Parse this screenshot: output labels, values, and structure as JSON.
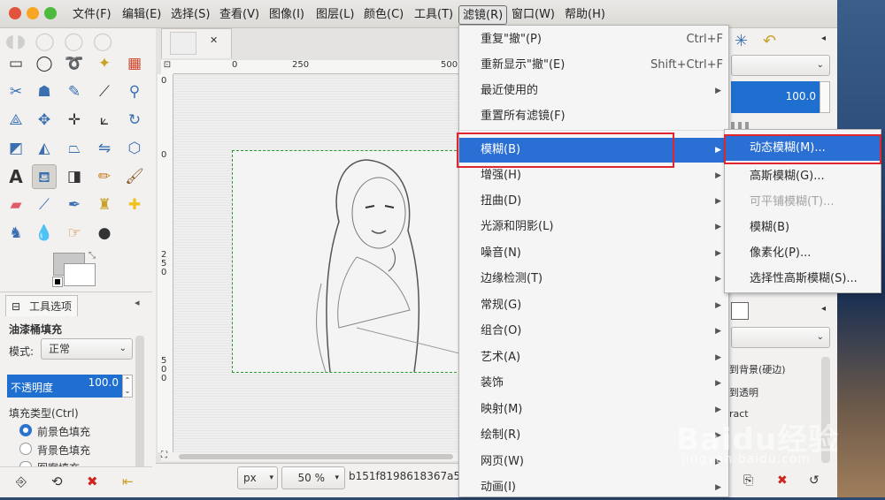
{
  "menubar": {
    "items": [
      "文件(F)",
      "编辑(E)",
      "选择(S)",
      "查看(V)",
      "图像(I)",
      "图层(L)",
      "颜色(C)",
      "工具(T)",
      "滤镜(R)",
      "窗口(W)",
      "帮助(H)"
    ],
    "active": "滤镜(R)"
  },
  "image_tab": {
    "close": "✕"
  },
  "ruler": {
    "h0": "0",
    "h250": "250",
    "h500": "500",
    "v0": "0",
    "v250": "250",
    "v500": "500"
  },
  "tool_options": {
    "tab_label": "工具选项",
    "title": "油漆桶填充",
    "mode_label": "模式:",
    "mode_value": "正常",
    "opacity_label": "不透明度",
    "opacity_value": "100.0",
    "fill_type_label": "填充类型(Ctrl)",
    "fill_options": [
      "前景色填充",
      "背景色填充",
      "图案填充"
    ],
    "fill_selected": 0
  },
  "statusbar": {
    "unit": "px",
    "zoom": "50 %",
    "filename": "b151f8198618367a5"
  },
  "filters_menu": {
    "items": [
      {
        "label": "重复\"撤\"(P)",
        "shortcut": "Ctrl+F"
      },
      {
        "label": "重新显示\"撤\"(E)",
        "shortcut": "Shift+Ctrl+F"
      },
      {
        "label": "最近使用的",
        "submenu": true
      },
      {
        "label": "重置所有滤镜(F)"
      },
      {
        "label": "模糊(B)",
        "submenu": true,
        "highlighted": true
      },
      {
        "label": "增强(H)",
        "submenu": true
      },
      {
        "label": "扭曲(D)",
        "submenu": true
      },
      {
        "label": "光源和阴影(L)",
        "submenu": true
      },
      {
        "label": "噪音(N)",
        "submenu": true
      },
      {
        "label": "边缘检测(T)",
        "submenu": true
      },
      {
        "label": "常规(G)",
        "submenu": true
      },
      {
        "label": "组合(O)",
        "submenu": true
      },
      {
        "label": "艺术(A)",
        "submenu": true
      },
      {
        "label": "装饰",
        "submenu": true
      },
      {
        "label": "映射(M)",
        "submenu": true
      },
      {
        "label": "绘制(R)",
        "submenu": true
      },
      {
        "label": "网页(W)",
        "submenu": true
      },
      {
        "label": "动画(I)",
        "submenu": true
      }
    ]
  },
  "blur_submenu": {
    "items": [
      {
        "label": "动态模糊(M)...",
        "highlighted": true
      },
      {
        "label": "高斯模糊(G)..."
      },
      {
        "label": "可平铺模糊(T)...",
        "disabled": true
      },
      {
        "label": "模糊(B)"
      },
      {
        "label": "像素化(P)..."
      },
      {
        "label": "选择性高斯模糊(S)..."
      }
    ]
  },
  "right_dock": {
    "opacity_value": "100.0",
    "list": [
      "到背景(硬边)",
      "到透明",
      "ract"
    ]
  },
  "watermark": {
    "main": "Baidu经验",
    "sub": "jingyan.baidu.com"
  },
  "colors": {
    "accent": "#2a6fd4",
    "highlight_box": "#e0272f"
  }
}
